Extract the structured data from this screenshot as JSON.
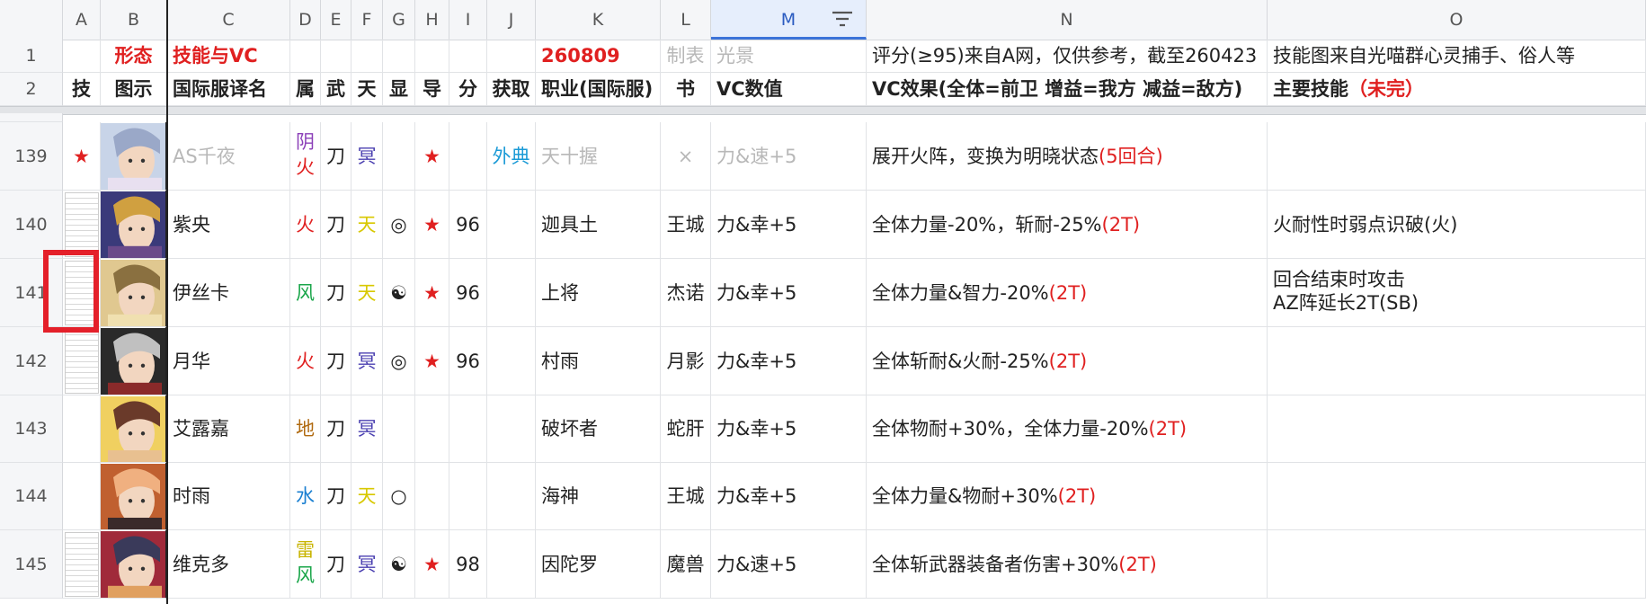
{
  "columns": [
    "A",
    "B",
    "C",
    "D",
    "E",
    "F",
    "G",
    "H",
    "I",
    "J",
    "K",
    "L",
    "M",
    "N",
    "O"
  ],
  "row1": {
    "num": "1",
    "B": "形态",
    "C": "技能与VC",
    "K": "260809",
    "L": "制表",
    "M": "光景",
    "N": "评分(≥95)来自A网，仅供参考，截至260423",
    "O": "技能图来自光喵群心灵捕手、俗人等"
  },
  "row2": {
    "num": "2",
    "A": "技",
    "B": "图示",
    "C": "国际服译名",
    "D": "属",
    "E": "武",
    "F": "天",
    "G": "显",
    "H": "导",
    "I": "分",
    "J": "获取",
    "K": "职业(国际服)",
    "L": "书",
    "M": "VC数值",
    "N": "VC效果(全体=前卫 增益=我方 减益=敌方)",
    "O_main": "主要技能",
    "O_note": "（未完）"
  },
  "rows": [
    {
      "num": "139",
      "A": "★",
      "C": "AS千夜",
      "D1": "阴",
      "D2": "火",
      "E": "刀",
      "F": "冥",
      "G": "",
      "H": "★",
      "I": "",
      "J": "外典",
      "K": "天十握",
      "L": "×",
      "M": "力&速+5",
      "N_main": "展开火阵，变换为明晓状态",
      "N_tail": "(5回合)",
      "O1": "",
      "O2": ""
    },
    {
      "num": "140",
      "A": "",
      "C": "紫央",
      "D1": "火",
      "D2": "",
      "E": "刀",
      "F": "天",
      "G": "◎",
      "H": "★",
      "I": "96",
      "J": "",
      "K": "迦具土",
      "L": "王城",
      "M": "力&幸+5",
      "N_main": "全体力量-20%，斩耐-25%",
      "N_tail": "(2T)",
      "O1": "火耐性时弱点识破(火)",
      "O2": ""
    },
    {
      "num": "141",
      "A": "",
      "C": "伊丝卡",
      "D1": "风",
      "D2": "",
      "E": "刀",
      "F": "天",
      "G": "☯",
      "H": "★",
      "I": "96",
      "J": "",
      "K": "上将",
      "L": "杰诺",
      "M": "力&幸+5",
      "N_main": "全体力量&智力-20%",
      "N_tail": "(2T)",
      "O1": "回合结束时攻击",
      "O2": "AZ阵延长2T(SB)"
    },
    {
      "num": "142",
      "A": "",
      "C": "月华",
      "D1": "火",
      "D2": "",
      "E": "刀",
      "F": "冥",
      "G": "◎",
      "H": "★",
      "I": "96",
      "J": "",
      "K": "村雨",
      "L": "月影",
      "M": "力&幸+5",
      "N_main": "全体斩耐&火耐-25%",
      "N_tail": "(2T)",
      "O1": "",
      "O2": ""
    },
    {
      "num": "143",
      "A": "",
      "C": "艾露嘉",
      "D1": "地",
      "D2": "",
      "E": "刀",
      "F": "冥",
      "G": "",
      "H": "",
      "I": "",
      "J": "",
      "K": "破坏者",
      "L": "蛇肝",
      "M": "力&幸+5",
      "N_main": "全体物耐+30%，全体力量-20%",
      "N_tail": "(2T)",
      "O1": "",
      "O2": ""
    },
    {
      "num": "144",
      "A": "",
      "C": "时雨",
      "D1": "水",
      "D2": "",
      "E": "刀",
      "F": "天",
      "G": "○",
      "H": "",
      "I": "",
      "J": "",
      "K": "海神",
      "L": "王城",
      "M": "力&幸+5",
      "N_main": "全体力量&物耐+30%",
      "N_tail": "(2T)",
      "O1": "",
      "O2": ""
    },
    {
      "num": "145",
      "A": "",
      "C": "维克多",
      "D1": "雷",
      "D2": "风",
      "E": "刀",
      "F": "冥",
      "G": "☯",
      "H": "★",
      "I": "98",
      "J": "",
      "K": "因陀罗",
      "L": "魔兽",
      "M": "力&速+5",
      "N_main": "全体斩武器装备者伤害+30%",
      "N_tail": "(2T)",
      "O1": "",
      "O2": ""
    }
  ],
  "colors": {
    "accent_red": "#e02020",
    "selection": "#e4202a",
    "fire": "#e02020",
    "wind": "#1aa64a",
    "earth": "#b06a10",
    "water": "#1a7fd1",
    "thunder": "#c8b400",
    "dark": "#8b3fb8",
    "heaven": "#d8c800",
    "underworld": "#4a3fb0",
    "link": "#1a9ad6"
  },
  "icons": {
    "filter": "filter-icon",
    "star": "star-icon"
  }
}
